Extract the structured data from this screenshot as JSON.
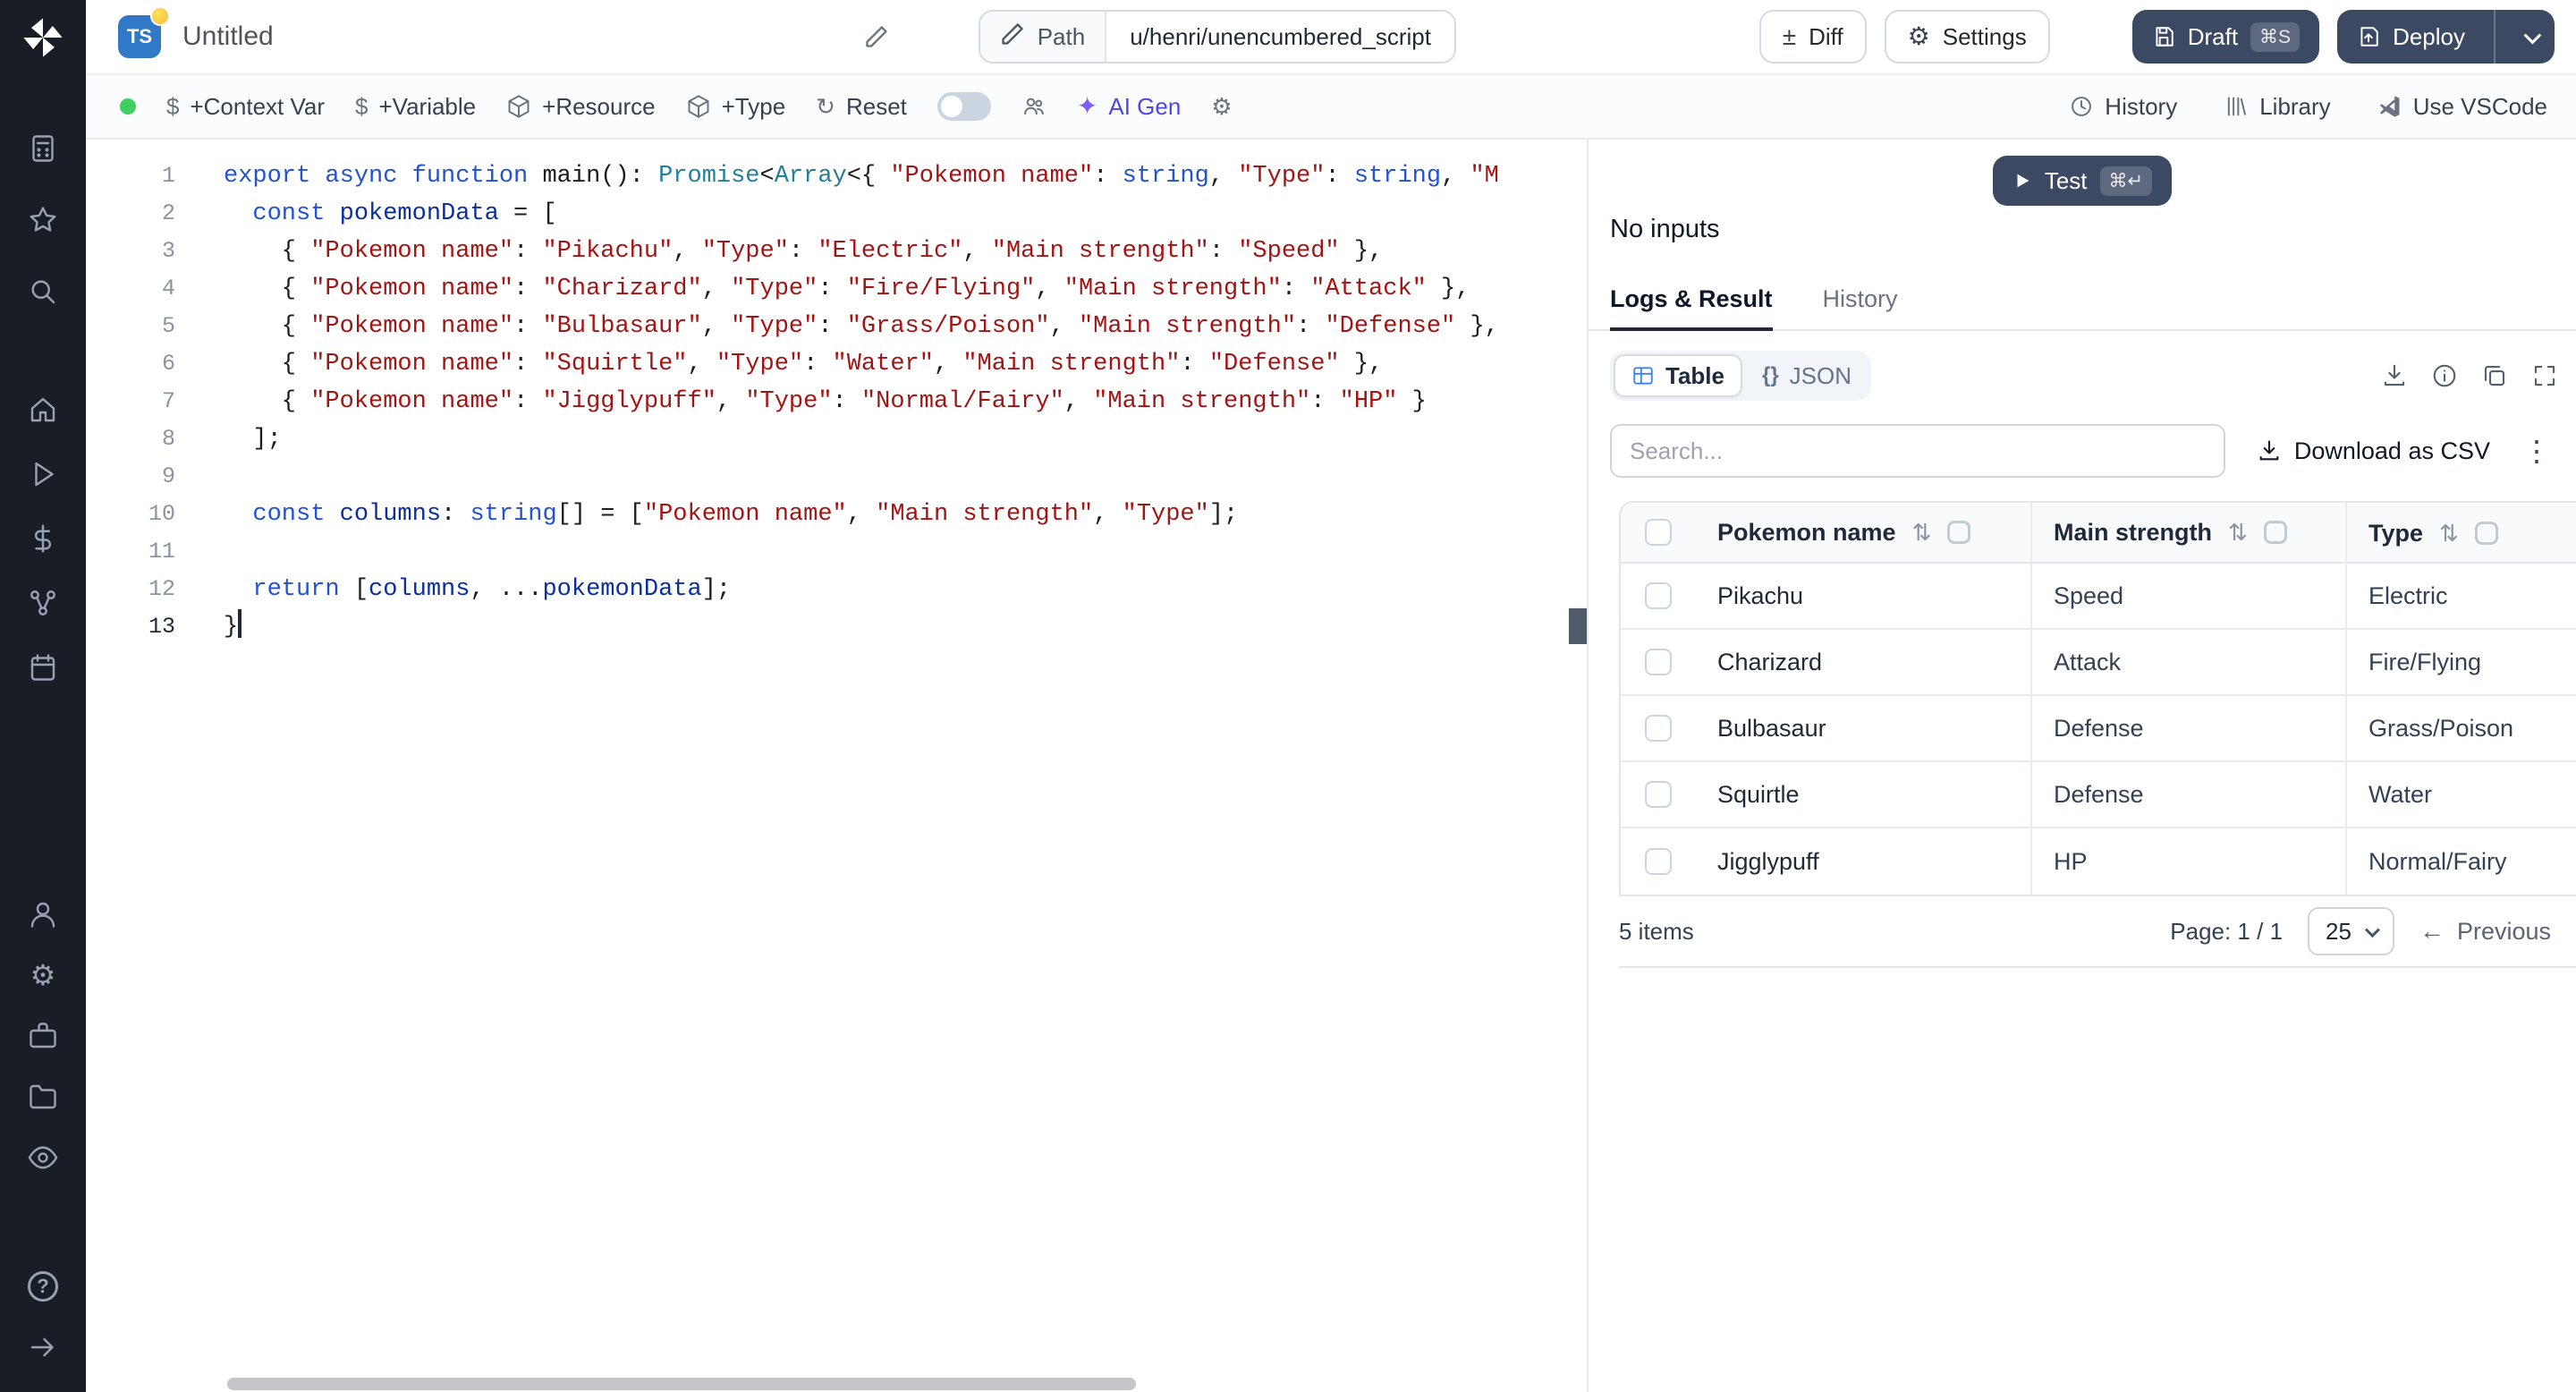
{
  "sidebar": {
    "icons": [
      "windmill-logo",
      "keypad-icon",
      "star-icon",
      "search-icon",
      "home-icon",
      "play-icon",
      "dollar-icon",
      "nodes-icon",
      "calendar-icon",
      "user-icon",
      "gear-icon",
      "briefcase-icon",
      "folder-icon",
      "eye-icon",
      "help-icon",
      "collapse-arrow-icon"
    ]
  },
  "topbar": {
    "language_badge": "TS",
    "title": "Untitled",
    "path_label": "Path",
    "path_value": "u/henri/unencumbered_script",
    "diff_label": "Diff",
    "diff_glyph": "±",
    "settings_label": "Settings",
    "settings_glyph": "⚙",
    "draft_label": "Draft",
    "draft_shortcut": "⌘S",
    "deploy_label": "Deploy"
  },
  "toolbar": {
    "add_context_var": "+Context Var",
    "add_variable": "+Variable",
    "add_resource": "+Resource",
    "add_type": "+Type",
    "reset": "Reset",
    "reset_glyph": "↻",
    "dollar_glyph": "$",
    "ai_gen": "AI Gen",
    "ai_gen_glyph": "✦",
    "gear_glyph": "⚙",
    "history": "History",
    "library": "Library",
    "use_vscode": "Use VSCode"
  },
  "editor": {
    "lines": [
      {
        "n": 1,
        "tokens": [
          [
            "k",
            "export"
          ],
          [
            "p",
            " "
          ],
          [
            "k",
            "async"
          ],
          [
            "p",
            " "
          ],
          [
            "k",
            "function"
          ],
          [
            "p",
            " "
          ],
          [
            "p",
            "main"
          ],
          [
            "p",
            "(): "
          ],
          [
            "t",
            "Promise"
          ],
          [
            "p",
            "<"
          ],
          [
            "t",
            "Array"
          ],
          [
            "p",
            "<{ "
          ],
          [
            "s",
            "\"Pokemon name\""
          ],
          [
            "p",
            ": "
          ],
          [
            "k",
            "string"
          ],
          [
            "p",
            ", "
          ],
          [
            "s",
            "\"Type\""
          ],
          [
            "p",
            ": "
          ],
          [
            "k",
            "string"
          ],
          [
            "p",
            ", "
          ],
          [
            "s",
            "\"M"
          ]
        ]
      },
      {
        "n": 2,
        "tokens": [
          [
            "p",
            "  "
          ],
          [
            "k",
            "const"
          ],
          [
            "p",
            " "
          ],
          [
            "v",
            "pokemonData"
          ],
          [
            "p",
            " = ["
          ]
        ]
      },
      {
        "n": 3,
        "tokens": [
          [
            "p",
            "    { "
          ],
          [
            "s",
            "\"Pokemon name\""
          ],
          [
            "p",
            ": "
          ],
          [
            "s",
            "\"Pikachu\""
          ],
          [
            "p",
            ", "
          ],
          [
            "s",
            "\"Type\""
          ],
          [
            "p",
            ": "
          ],
          [
            "s",
            "\"Electric\""
          ],
          [
            "p",
            ", "
          ],
          [
            "s",
            "\"Main strength\""
          ],
          [
            "p",
            ": "
          ],
          [
            "s",
            "\"Speed\""
          ],
          [
            "p",
            " },"
          ]
        ]
      },
      {
        "n": 4,
        "tokens": [
          [
            "p",
            "    { "
          ],
          [
            "s",
            "\"Pokemon name\""
          ],
          [
            "p",
            ": "
          ],
          [
            "s",
            "\"Charizard\""
          ],
          [
            "p",
            ", "
          ],
          [
            "s",
            "\"Type\""
          ],
          [
            "p",
            ": "
          ],
          [
            "s",
            "\"Fire/Flying\""
          ],
          [
            "p",
            ", "
          ],
          [
            "s",
            "\"Main strength\""
          ],
          [
            "p",
            ": "
          ],
          [
            "s",
            "\"Attack\""
          ],
          [
            "p",
            " },"
          ]
        ]
      },
      {
        "n": 5,
        "tokens": [
          [
            "p",
            "    { "
          ],
          [
            "s",
            "\"Pokemon name\""
          ],
          [
            "p",
            ": "
          ],
          [
            "s",
            "\"Bulbasaur\""
          ],
          [
            "p",
            ", "
          ],
          [
            "s",
            "\"Type\""
          ],
          [
            "p",
            ": "
          ],
          [
            "s",
            "\"Grass/Poison\""
          ],
          [
            "p",
            ", "
          ],
          [
            "s",
            "\"Main strength\""
          ],
          [
            "p",
            ": "
          ],
          [
            "s",
            "\"Defense\""
          ],
          [
            "p",
            " },"
          ]
        ]
      },
      {
        "n": 6,
        "tokens": [
          [
            "p",
            "    { "
          ],
          [
            "s",
            "\"Pokemon name\""
          ],
          [
            "p",
            ": "
          ],
          [
            "s",
            "\"Squirtle\""
          ],
          [
            "p",
            ", "
          ],
          [
            "s",
            "\"Type\""
          ],
          [
            "p",
            ": "
          ],
          [
            "s",
            "\"Water\""
          ],
          [
            "p",
            ", "
          ],
          [
            "s",
            "\"Main strength\""
          ],
          [
            "p",
            ": "
          ],
          [
            "s",
            "\"Defense\""
          ],
          [
            "p",
            " },"
          ]
        ]
      },
      {
        "n": 7,
        "tokens": [
          [
            "p",
            "    { "
          ],
          [
            "s",
            "\"Pokemon name\""
          ],
          [
            "p",
            ": "
          ],
          [
            "s",
            "\"Jigglypuff\""
          ],
          [
            "p",
            ", "
          ],
          [
            "s",
            "\"Type\""
          ],
          [
            "p",
            ": "
          ],
          [
            "s",
            "\"Normal/Fairy\""
          ],
          [
            "p",
            ", "
          ],
          [
            "s",
            "\"Main strength\""
          ],
          [
            "p",
            ": "
          ],
          [
            "s",
            "\"HP\""
          ],
          [
            "p",
            " }"
          ]
        ]
      },
      {
        "n": 8,
        "tokens": [
          [
            "p",
            "  ];"
          ]
        ]
      },
      {
        "n": 9,
        "tokens": []
      },
      {
        "n": 10,
        "tokens": [
          [
            "p",
            "  "
          ],
          [
            "k",
            "const"
          ],
          [
            "p",
            " "
          ],
          [
            "v",
            "columns"
          ],
          [
            "p",
            ": "
          ],
          [
            "k",
            "string"
          ],
          [
            "p",
            "[] = ["
          ],
          [
            "s",
            "\"Pokemon name\""
          ],
          [
            "p",
            ", "
          ],
          [
            "s",
            "\"Main strength\""
          ],
          [
            "p",
            ", "
          ],
          [
            "s",
            "\"Type\""
          ],
          [
            "p",
            "];"
          ]
        ]
      },
      {
        "n": 11,
        "tokens": []
      },
      {
        "n": 12,
        "tokens": [
          [
            "p",
            "  "
          ],
          [
            "k",
            "return"
          ],
          [
            "p",
            " ["
          ],
          [
            "v",
            "columns"
          ],
          [
            "p",
            ", ..."
          ],
          [
            "v",
            "pokemonData"
          ],
          [
            "p",
            "];"
          ]
        ]
      },
      {
        "n": 13,
        "tokens": [
          [
            "p",
            "}"
          ]
        ],
        "cursor": true,
        "active": true
      }
    ],
    "syntax_colors": {
      "keyword": "#2452d5",
      "string": "#a31515",
      "type": "#267f99",
      "variable": "#0b2f9e",
      "plain": "#1e1e1e"
    }
  },
  "panel": {
    "test": "Test",
    "test_shortcut": "⌘↵",
    "no_inputs": "No inputs",
    "tab_logs": "Logs & Result",
    "tab_history": "History",
    "toggle_table": "Table",
    "toggle_json_braces": "{}",
    "toggle_json": "JSON",
    "search_placeholder": "Search...",
    "download_csv": "Download as CSV",
    "kebab_glyph": "⋮",
    "table": {
      "headers": [
        "Pokemon name",
        "Main strength",
        "Type"
      ],
      "sort_glyph": "⇅",
      "rows": [
        [
          "Pikachu",
          "Speed",
          "Electric"
        ],
        [
          "Charizard",
          "Attack",
          "Fire/Flying"
        ],
        [
          "Bulbasaur",
          "Defense",
          "Grass/Poison"
        ],
        [
          "Squirtle",
          "Defense",
          "Water"
        ],
        [
          "Jigglypuff",
          "HP",
          "Normal/Fairy"
        ]
      ]
    },
    "footer": {
      "count": "5 items",
      "page": "Page: 1 / 1",
      "page_size": "25",
      "previous_arrow": "←",
      "previous": "Previous"
    }
  },
  "colors": {
    "sidebar_bg": "#191d26",
    "dark_button": "#3b4963",
    "status_green": "#3ecf5f",
    "ts_badge": "#3178c6",
    "accent_ai": "#4f46e5",
    "border": "#e5e7eb"
  }
}
